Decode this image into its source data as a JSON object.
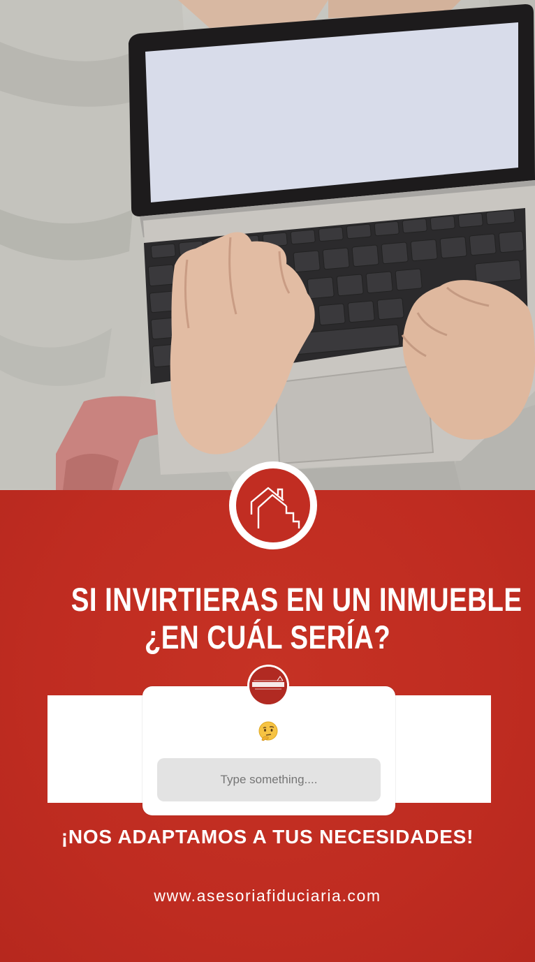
{
  "story": {
    "headline_line1": "SI INVIRTIERAS EN UN INMUEBLE",
    "headline_line2": "¿EN CUÁL SERÍA?",
    "question_sticker": {
      "avatar_brand_text": "Asesoría Fiduciaria",
      "emoji": "thinking-face-emoji",
      "input_placeholder": "Type something...."
    },
    "tagline": "¡NOS ADAPTAMOS A TUS NECESIDADES!",
    "website": "www.asesoriafiduciaria.com"
  },
  "colors": {
    "brand_red": "#c12d22",
    "white": "#ffffff",
    "input_gray": "#e3e3e3"
  },
  "icons": {
    "badge": "house-outline-icon"
  }
}
